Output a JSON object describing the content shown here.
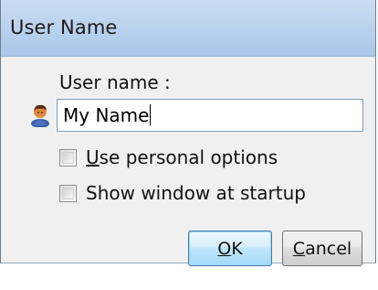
{
  "window": {
    "title": "User Name"
  },
  "form": {
    "label": "User name :",
    "input_value": "My Name",
    "checkboxes": [
      {
        "mnemonic": "U",
        "rest": "se personal options",
        "checked": false
      },
      {
        "mnemonic": "",
        "rest": "Show window at startup",
        "checked": false
      }
    ]
  },
  "buttons": {
    "ok": {
      "mnemonic": "O",
      "rest": "K"
    },
    "cancel": {
      "mnemonic": "C",
      "rest": "ancel"
    }
  },
  "icons": {
    "user": "user-icon"
  },
  "colors": {
    "titlebar": "#bcd3ee",
    "dialog_bg": "#f0f0f0",
    "ok_border": "#3c7fb1"
  }
}
